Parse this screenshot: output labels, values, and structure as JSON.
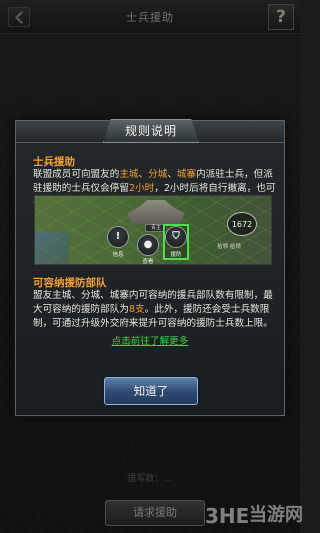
{
  "screen": {
    "title": "士兵援助",
    "help_glyph": "?",
    "bottom_button": "请求援助",
    "bottom_hint": "援军数：…"
  },
  "dialog": {
    "title": "规则说明",
    "section1": {
      "title": "士兵援助",
      "text_a": "联盟成员可向盟友的",
      "city_main": "主城",
      "sep1": "、",
      "city_branch": "分城",
      "sep2": "、",
      "city_fort": "城寨",
      "text_b": "内派驻士兵，但派驻援助的士兵仅会停留",
      "duration": "2小时",
      "text_c": "，2小时后将自行撤离，也可手动撤离。"
    },
    "section2": {
      "title": "可容纳援防部队",
      "text_a": "盟友主城、分城、城寨内可容纳的援兵部队数有限制，最大可容纳的援防部队为",
      "max_count": "8支",
      "text_b": "。此外，援防还会受士兵数限制，可通过升级外交府来提升可容纳的援防士兵数上限。"
    },
    "link": "点击前往了解更多",
    "ok_button": "知道了"
  },
  "map_image": {
    "castle_name": "青主",
    "btn_info_glyph": "!",
    "btn_info_label": "信息",
    "btn_enter_glyph": "●",
    "btn_enter_label": "查看",
    "btn_aid_glyph": "⛉",
    "btn_aid_label": "援防",
    "badge_value": "1672",
    "owner_text": "拾领 拾领"
  },
  "watermark": {
    "text": "当游网"
  },
  "colors": {
    "highlight": "#f0a034",
    "link": "#3fd04a",
    "button_blue": "#2e4a72"
  }
}
